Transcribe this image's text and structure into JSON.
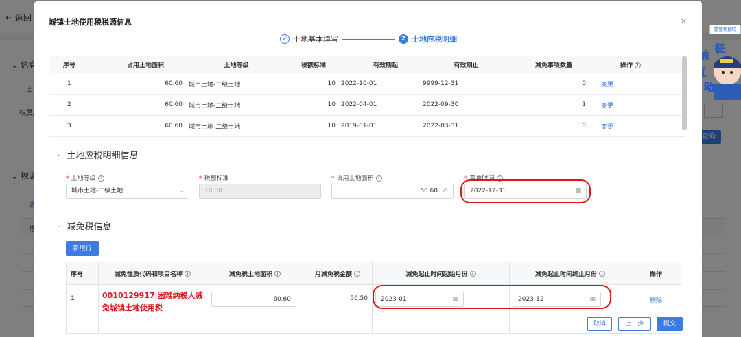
{
  "background": {
    "back_label": "返回",
    "side_texts": [
      "信息",
      "土",
      "权属/",
      "税源"
    ],
    "tab_text": "城",
    "table_header_text": "序",
    "query_button": "查询"
  },
  "side_badge": "需要帮助吗",
  "mascot_chars": [
    "征",
    "纳",
    "互",
    "动"
  ],
  "modal": {
    "title": "城镇土地使用税税源信息",
    "close_icon": "×",
    "steps": [
      {
        "label": "土地基本填写",
        "state": "done"
      },
      {
        "label": "土地应税明细",
        "number": "2",
        "state": "active"
      }
    ]
  },
  "top_table": {
    "headers": [
      "序号",
      "占用土地面积",
      "土地等级",
      "税额标准",
      "有效期起",
      "有效期止",
      "减免事项数量",
      "操作"
    ],
    "rows": [
      {
        "no": "1",
        "area": "60.60",
        "grade": "城市土地-二级土地",
        "rate": "10",
        "start": "2022-10-01",
        "end": "9999-12-31",
        "count": "0",
        "action": "变更"
      },
      {
        "no": "2",
        "area": "60.60",
        "grade": "城市土地-二级土地",
        "rate": "10",
        "start": "2022-04-01",
        "end": "2022-09-30",
        "count": "1",
        "action": "变更"
      },
      {
        "no": "3",
        "area": "60.60",
        "grade": "城市土地-二级土地",
        "rate": "10",
        "start": "2019-01-01",
        "end": "2022-03-31",
        "count": "0",
        "action": "变更"
      }
    ]
  },
  "detail_section": {
    "title": "土地应税明细信息",
    "fields": {
      "grade_label": "土地等级",
      "grade_value": "城市土地-二级土地",
      "rate_label": "税额标准",
      "rate_value": "10.00",
      "area_label": "占用土地面积",
      "area_value": "60.60",
      "change_label": "变更时间",
      "change_value": "2022-12-31"
    }
  },
  "exempt_section": {
    "title": "减免税信息",
    "add_button": "新增行",
    "headers": [
      "序号",
      "减免性质代码和项目名称",
      "减免税土地面积",
      "月减免税金额",
      "减免起止时间起始月份",
      "减免起止时间终止月份",
      "操作"
    ],
    "row": {
      "no": "1",
      "name": "0010129917|困难纳税人减免城镇土地使用税",
      "name_line1": "0010129917|困难纳税人减",
      "name_line2": "免城镇土地使用税",
      "area": "60.60",
      "amount": "50.50",
      "start_month": "2023-01",
      "end_month": "2023-12",
      "action": "删除"
    }
  },
  "footer": {
    "cancel": "取消",
    "prev": "上一步",
    "submit": "提交"
  },
  "colors": {
    "primary": "#3d7be0",
    "highlight_red": "#e0161e"
  }
}
